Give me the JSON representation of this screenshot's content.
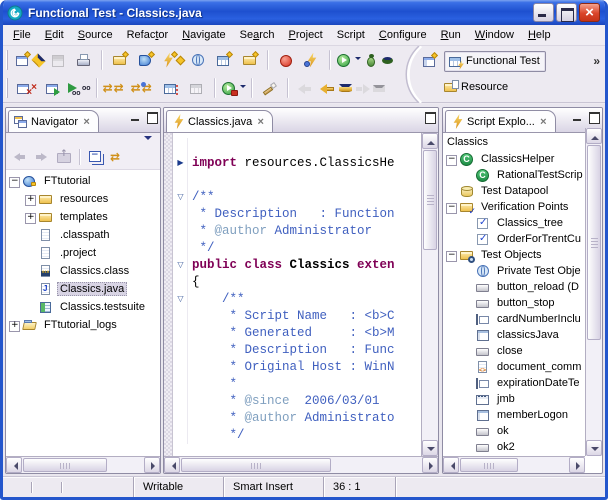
{
  "window": {
    "title": "Functional Test - Classics.java"
  },
  "menu": {
    "items": [
      {
        "pre": "",
        "key": "F",
        "post": "ile"
      },
      {
        "pre": "",
        "key": "E",
        "post": "dit"
      },
      {
        "pre": "",
        "key": "S",
        "post": "ource"
      },
      {
        "pre": "Refac",
        "key": "t",
        "post": "or"
      },
      {
        "pre": "",
        "key": "N",
        "post": "avigate"
      },
      {
        "pre": "Se",
        "key": "a",
        "post": "rch"
      },
      {
        "pre": "",
        "key": "P",
        "post": "roject"
      },
      {
        "pre": "Script",
        "key": "",
        "post": ""
      },
      {
        "pre": "",
        "key": "C",
        "post": "onfigure"
      },
      {
        "pre": "",
        "key": "R",
        "post": "un"
      },
      {
        "pre": "",
        "key": "W",
        "post": "indow"
      },
      {
        "pre": "",
        "key": "H",
        "post": "elp"
      }
    ]
  },
  "toolbar": {
    "row1": [
      {
        "name": "toolbar-grip",
        "icon": "grip",
        "i": "false"
      },
      {
        "name": "new-wizard-button",
        "icon": "new-wizard",
        "dd": "1"
      },
      {
        "name": "save-button",
        "icon": "save",
        "dis": "1"
      },
      {
        "name": "print-button",
        "icon": "print"
      },
      {
        "name": "separator",
        "icon": "sep",
        "i": "false"
      },
      {
        "name": "new-test-project-button",
        "icon": "folder-star"
      },
      {
        "name": "new-ft-project-button",
        "icon": "book-star"
      },
      {
        "name": "new-script-button",
        "icon": "script-star"
      },
      {
        "name": "new-test-object-map-button",
        "icon": "globe-star"
      },
      {
        "name": "new-datapool-button",
        "icon": "grid-star"
      },
      {
        "name": "new-folder-button",
        "icon": "folder-star"
      },
      {
        "name": "separator",
        "icon": "sep",
        "i": "false"
      },
      {
        "name": "record-button",
        "icon": "record"
      },
      {
        "name": "insert-recording-button",
        "icon": "insert-rec"
      },
      {
        "name": "separator",
        "icon": "sep",
        "i": "false"
      },
      {
        "name": "run-button",
        "icon": "run",
        "dd": "1"
      },
      {
        "name": "debug-button",
        "icon": "debug",
        "dd": "1"
      }
    ],
    "row2": [
      {
        "name": "toolbar-grip",
        "icon": "grip",
        "i": "false"
      },
      {
        "name": "stop-display-button",
        "icon": "win-x"
      },
      {
        "name": "run-display-button",
        "icon": "win-play"
      },
      {
        "name": "view-results-button",
        "icon": "play-glasses"
      },
      {
        "name": "separator",
        "icon": "sep",
        "i": "false"
      },
      {
        "name": "insert-verification-point-button",
        "icon": "swap1"
      },
      {
        "name": "update-recording-button",
        "icon": "swap2"
      },
      {
        "name": "insert-datapool-button",
        "icon": "grid-dots"
      },
      {
        "name": "edit-datapool-button",
        "icon": "grid-gray",
        "dis": "1"
      },
      {
        "name": "separator",
        "icon": "sep",
        "i": "false"
      },
      {
        "name": "run-script-button",
        "icon": "run-case",
        "dd": "1"
      },
      {
        "name": "separator",
        "icon": "sep",
        "i": "false"
      },
      {
        "name": "highlight-button",
        "icon": "brush"
      },
      {
        "name": "separator",
        "icon": "sep",
        "i": "false"
      },
      {
        "name": "back-small-button",
        "icon": "back-gray",
        "dis": "1"
      },
      {
        "name": "back-button",
        "icon": "back-gold",
        "dd": "1"
      },
      {
        "name": "forward-button",
        "icon": "fwd-gray",
        "dis": "1",
        "dd": "1"
      }
    ]
  },
  "perspective": {
    "chevron": "»",
    "items": [
      {
        "label": "Functional Test",
        "active": true
      },
      {
        "label": "Resource",
        "active": false
      }
    ]
  },
  "navigator": {
    "tab": "Navigator",
    "tree": [
      {
        "label": "FTtutorial",
        "icon": "project",
        "depth": 0,
        "exp": "minus"
      },
      {
        "label": "resources",
        "icon": "folder",
        "depth": 1,
        "exp": "plus"
      },
      {
        "label": "templates",
        "icon": "folder",
        "depth": 1,
        "exp": "plus"
      },
      {
        "label": ".classpath",
        "icon": "page",
        "depth": 1
      },
      {
        "label": ".project",
        "icon": "page",
        "depth": 1
      },
      {
        "label": "Classics.class",
        "icon": "class-file",
        "depth": 1
      },
      {
        "label": "Classics.java",
        "icon": "java-file",
        "depth": 1,
        "sel": "1"
      },
      {
        "label": "Classics.testsuite",
        "icon": "testsuite",
        "depth": 1
      },
      {
        "label": "FTtutorial_logs",
        "icon": "folder-open",
        "depth": 0,
        "exp": "plus"
      }
    ]
  },
  "editor": {
    "tab": "Classics.java",
    "lines": [
      {
        "fold": "",
        "tokens": []
      },
      {
        "fold": "c",
        "tokens": [
          {
            "c": "k",
            "t": "import"
          },
          {
            "c": "p",
            "t": " resources.ClassicsHe"
          }
        ]
      },
      {
        "fold": "",
        "tokens": []
      },
      {
        "fold": "o",
        "tokens": [
          {
            "c": "d",
            "t": "/**"
          }
        ]
      },
      {
        "fold": "",
        "tokens": [
          {
            "c": "d",
            "t": " * Description   : Function"
          }
        ]
      },
      {
        "fold": "",
        "tokens": [
          {
            "c": "d",
            "t": " * "
          },
          {
            "c": "t",
            "t": "@author"
          },
          {
            "c": "d",
            "t": " Administrator"
          }
        ]
      },
      {
        "fold": "",
        "tokens": [
          {
            "c": "d",
            "t": " */"
          }
        ]
      },
      {
        "fold": "o",
        "tokens": [
          {
            "c": "k",
            "t": "public class"
          },
          {
            "c": "pb",
            "t": " Classics "
          },
          {
            "c": "k",
            "t": "exten"
          }
        ]
      },
      {
        "fold": "",
        "tokens": [
          {
            "c": "p",
            "t": "{"
          }
        ]
      },
      {
        "fold": "o",
        "tokens": [
          {
            "c": "d",
            "t": "    /**"
          }
        ]
      },
      {
        "fold": "",
        "tokens": [
          {
            "c": "d",
            "t": "     * Script Name   : <b>C"
          }
        ]
      },
      {
        "fold": "",
        "tokens": [
          {
            "c": "d",
            "t": "     * Generated     : <b>M"
          }
        ]
      },
      {
        "fold": "",
        "tokens": [
          {
            "c": "d",
            "t": "     * Description   : Func"
          }
        ]
      },
      {
        "fold": "",
        "tokens": [
          {
            "c": "d",
            "t": "     * Original Host : WinN"
          }
        ]
      },
      {
        "fold": "",
        "tokens": [
          {
            "c": "d",
            "t": "     *"
          }
        ]
      },
      {
        "fold": "",
        "tokens": [
          {
            "c": "d",
            "t": "     * "
          },
          {
            "c": "t",
            "t": "@since"
          },
          {
            "c": "d",
            "t": "  2006/03/01"
          }
        ]
      },
      {
        "fold": "",
        "tokens": [
          {
            "c": "d",
            "t": "     * "
          },
          {
            "c": "t",
            "t": "@author"
          },
          {
            "c": "d",
            "t": " Administrato"
          }
        ]
      },
      {
        "fold": "",
        "tokens": [
          {
            "c": "d",
            "t": "     */"
          }
        ]
      }
    ]
  },
  "script_explorer": {
    "tab": "Script Explo...",
    "header": "Classics",
    "tree": [
      {
        "label": "ClassicsHelper",
        "icon": "c-green",
        "depth": 0,
        "exp": "minus"
      },
      {
        "label": "RationalTestScrip",
        "icon": "c-green",
        "depth": 1
      },
      {
        "label": "Test Datapool",
        "icon": "datapool",
        "depth": 0
      },
      {
        "label": "Verification Points",
        "icon": "vp-folder",
        "depth": 0,
        "exp": "minus"
      },
      {
        "label": "Classics_tree",
        "icon": "vp-check",
        "depth": 1
      },
      {
        "label": "OrderForTrentCu",
        "icon": "vp-check",
        "depth": 1
      },
      {
        "label": "Test Objects",
        "icon": "to-folder",
        "depth": 0,
        "exp": "minus"
      },
      {
        "label": "Private Test Obje",
        "icon": "globe",
        "depth": 1
      },
      {
        "label": "button_reload (D",
        "icon": "button",
        "depth": 1
      },
      {
        "label": "button_stop",
        "icon": "button",
        "depth": 1
      },
      {
        "label": "cardNumberInclu",
        "icon": "textfield",
        "depth": 1
      },
      {
        "label": "classicsJava",
        "icon": "frame",
        "depth": 1
      },
      {
        "label": "close",
        "icon": "button",
        "depth": 1
      },
      {
        "label": "document_comm",
        "icon": "doc-code",
        "depth": 1
      },
      {
        "label": "expirationDateTe",
        "icon": "textfield",
        "depth": 1
      },
      {
        "label": "jmb",
        "icon": "menubar",
        "depth": 1
      },
      {
        "label": "memberLogon",
        "icon": "frame",
        "depth": 1
      },
      {
        "label": "ok",
        "icon": "button",
        "depth": 1
      },
      {
        "label": "ok2",
        "icon": "button",
        "depth": 1
      },
      {
        "label": "",
        "icon": "button",
        "depth": 1
      }
    ]
  },
  "status": {
    "writable": "Writable",
    "insert_mode": "Smart Insert",
    "position": "36 : 1"
  },
  "icon_glyphs": {
    "close": "×",
    "check": "✓",
    "chevron": "»",
    "fold-open": "▽",
    "fold-closed": "▶",
    "link-swap": "⇄",
    "accent_blue": "#1e50cf",
    "keyword_color": "#7f0055",
    "javadoc_color": "#3f5fbf",
    "javadoc_tag_color": "#7f9fbf"
  }
}
